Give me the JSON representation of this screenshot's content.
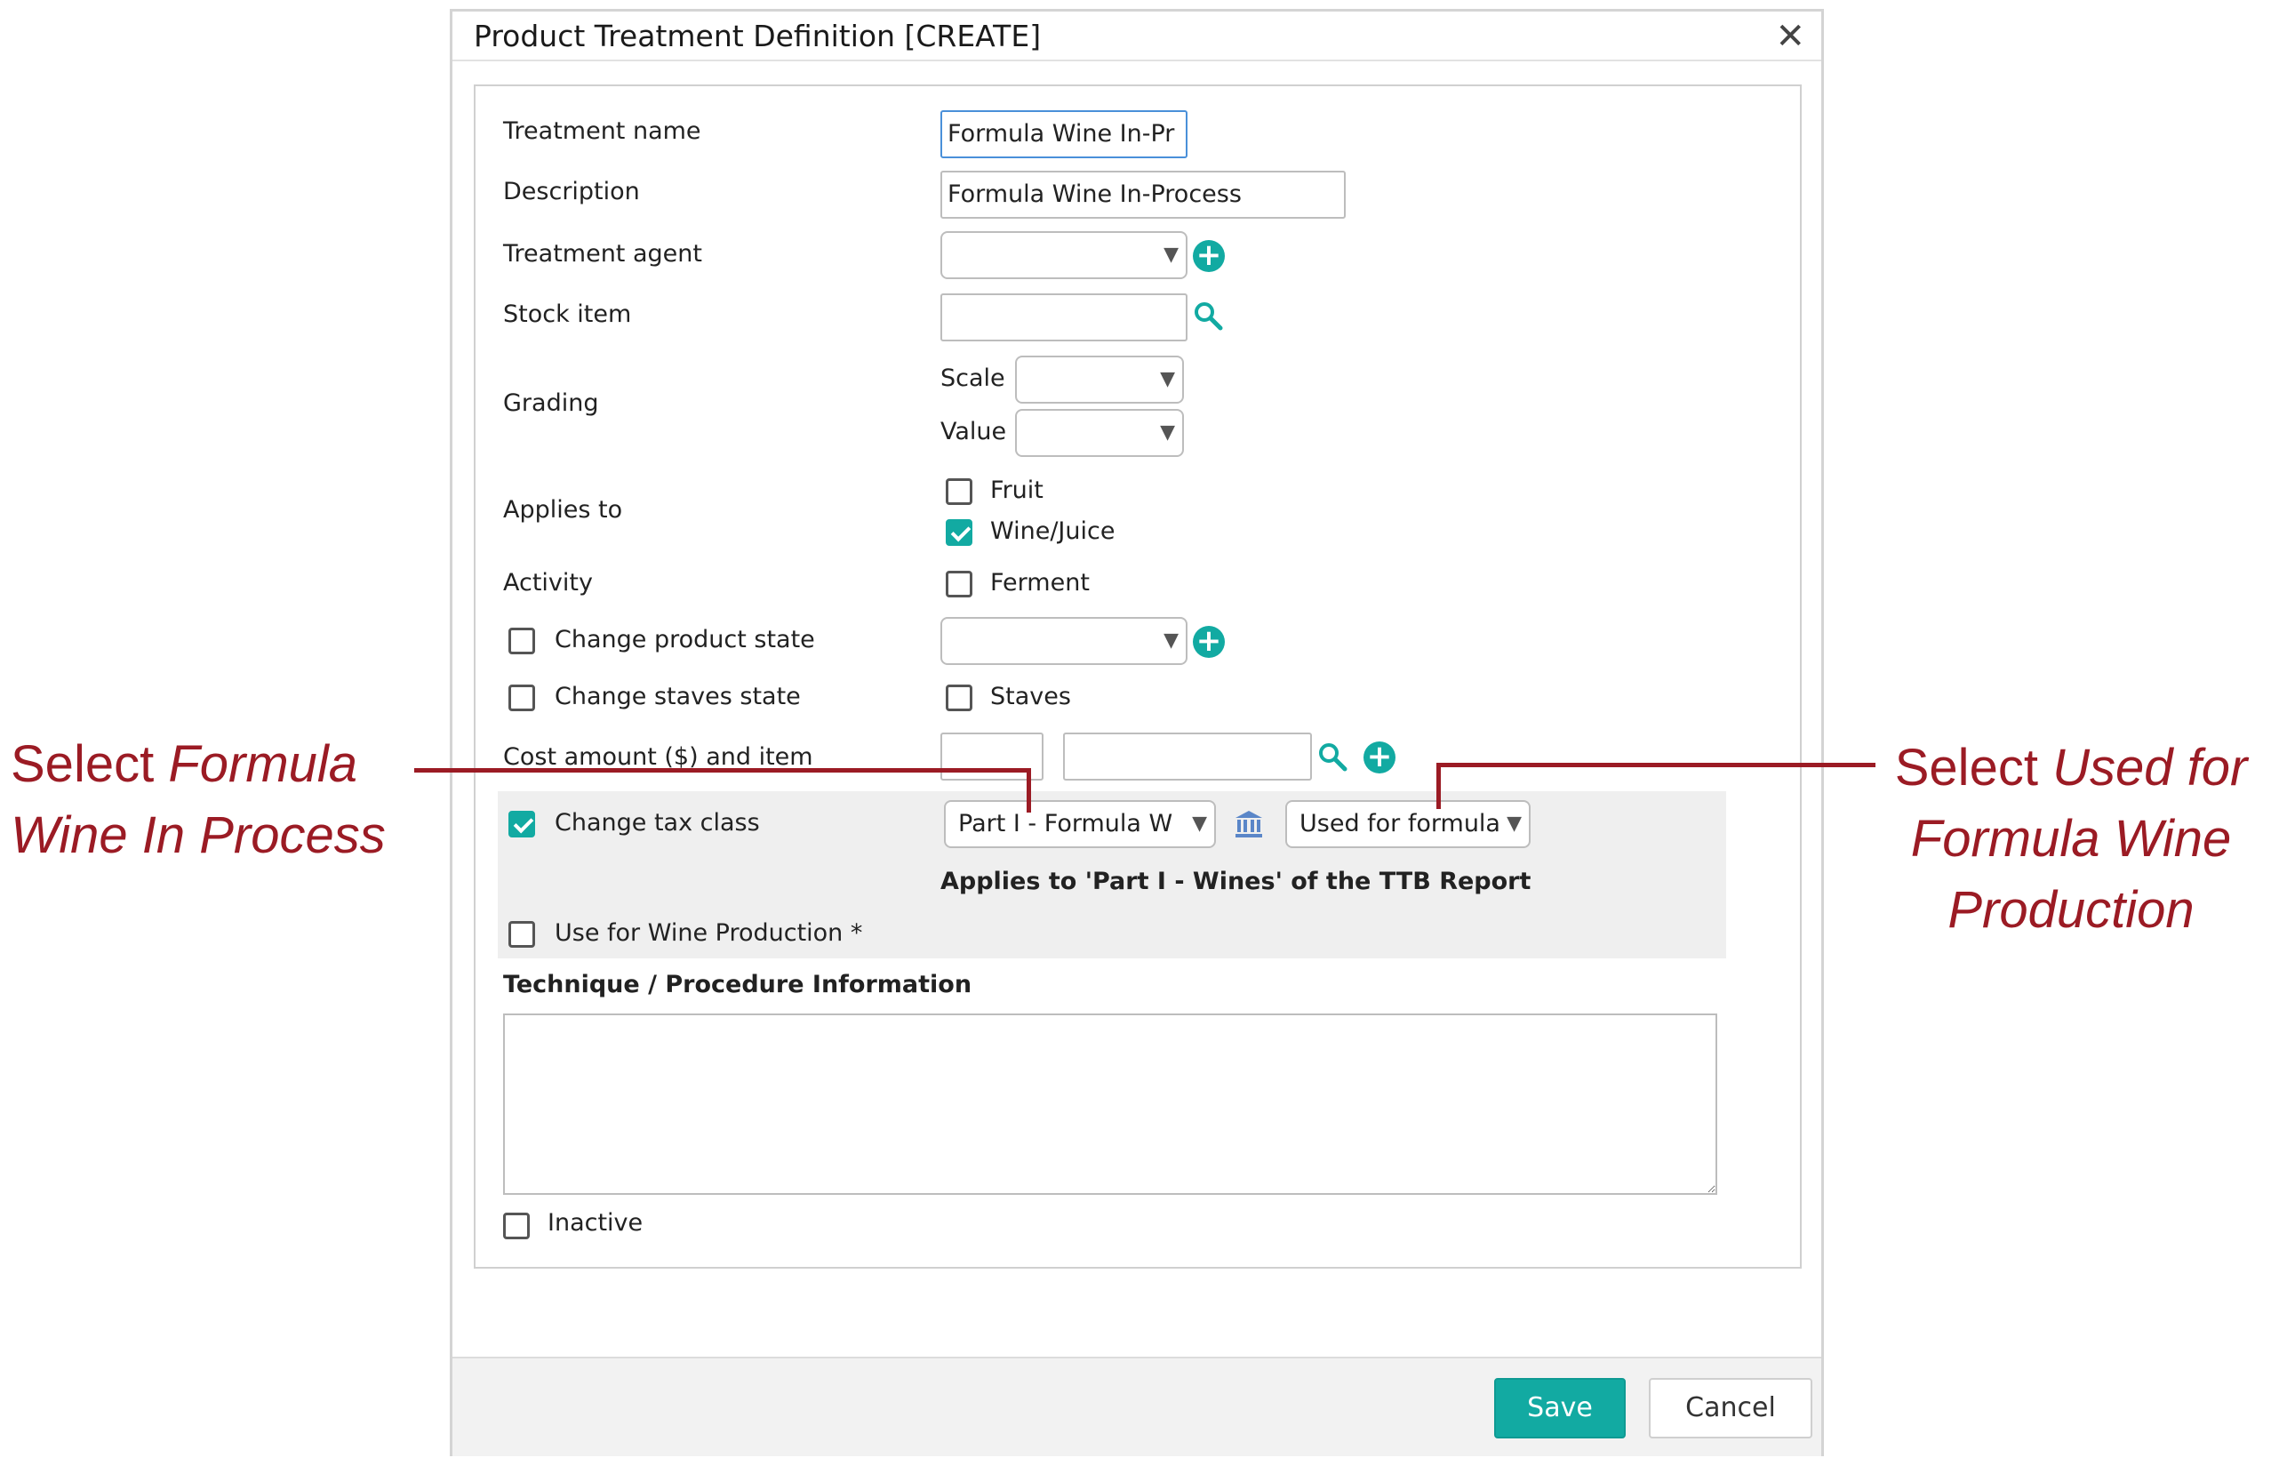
{
  "dialog": {
    "title": "Product Treatment Definition [CREATE]",
    "close_label": "✕"
  },
  "form": {
    "treatment_name_label": "Treatment name",
    "treatment_name_value": "Formula Wine In-Pr",
    "description_label": "Description",
    "description_value": "Formula Wine In-Process",
    "treatment_agent_label": "Treatment agent",
    "stock_item_label": "Stock item",
    "grading_label": "Grading",
    "scale_label": "Scale",
    "value_label": "Value",
    "applies_to_label": "Applies to",
    "fruit_label": "Fruit",
    "wine_juice_label": "Wine/Juice",
    "activity_label": "Activity",
    "ferment_label": "Ferment",
    "change_product_state_label": "Change product state",
    "change_staves_state_label": "Change staves state",
    "staves_label": "Staves",
    "cost_label": "Cost amount ($) and item",
    "change_tax_class_label": "Change tax class",
    "tax_class_value": "Part I - Formula W",
    "tax_use_value": "Used for formula",
    "applies_ttb_text": "Applies to 'Part I - Wines' of the TTB Report",
    "use_wine_production_label": "Use for Wine Production *",
    "technique_label": "Technique / Procedure Information",
    "inactive_label": "Inactive"
  },
  "footer": {
    "save_label": "Save",
    "cancel_label": "Cancel"
  },
  "annotations": {
    "left_line1_plain": "Select ",
    "left_line1_italic": "Formula",
    "left_line2_italic": "Wine In Process",
    "right_line1_plain": "Select ",
    "right_line1_italic": "Used for",
    "right_line2_italic": "Formula Wine",
    "right_line3_italic": "Production"
  },
  "colors": {
    "accent": "#12aaa2",
    "annotation": "#9b1b24"
  }
}
